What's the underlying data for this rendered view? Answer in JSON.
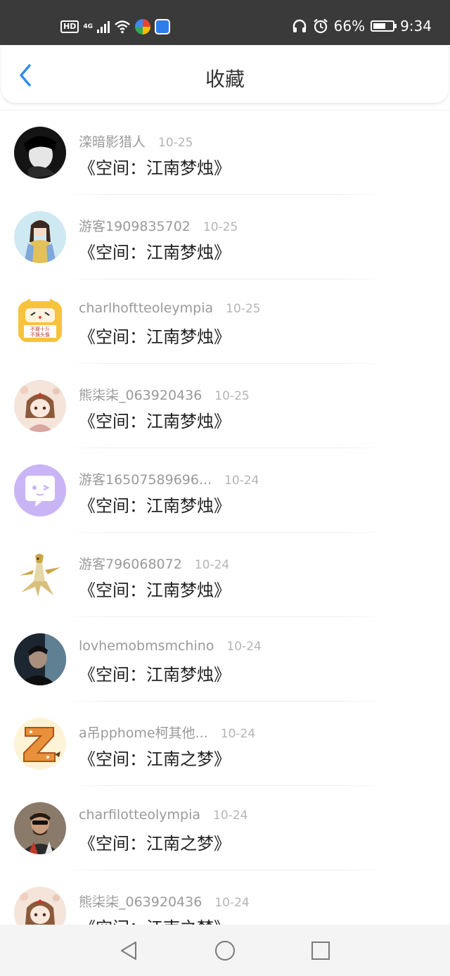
{
  "status_bar": {
    "hd": "HD",
    "network": "4G",
    "battery_percent": "66%",
    "time": "9:34",
    "battery_level": 0.66,
    "icons": [
      "hd-icon",
      "signal-icon",
      "wifi-icon",
      "app-notification-icon",
      "app-notification-icon",
      "headphones-icon",
      "alarm-icon",
      "battery-icon"
    ]
  },
  "header": {
    "title": "收藏",
    "back_icon": "chevron-left-icon",
    "accent_color": "#2d8cf0"
  },
  "items": [
    {
      "username": "滦暗影猎人",
      "date": "10-25",
      "work": "《空间：江南梦烛》"
    },
    {
      "username": "游客1909835702",
      "date": "10-25",
      "work": "《空间：江南梦烛》"
    },
    {
      "username": "charlhoftteoleympia",
      "date": "10-25",
      "work": "《空间：江南梦烛》"
    },
    {
      "username": "熊柒柒_063920436",
      "date": "10-25",
      "work": "《空间：江南梦烛》"
    },
    {
      "username": "游客16507589696...",
      "date": "10-24",
      "work": "《空间：江南梦烛》"
    },
    {
      "username": "游客796068072",
      "date": "10-24",
      "work": "《空间：江南梦烛》"
    },
    {
      "username": "lovhemobmsmchino",
      "date": "10-24",
      "work": "《空间：江南梦烛》"
    },
    {
      "username": "a吊pphome柯其他...",
      "date": "10-24",
      "work": "《空间：江南之梦》"
    },
    {
      "username": "charfilotteolympia",
      "date": "10-24",
      "work": "《空间：江南之梦》"
    },
    {
      "username": "熊柒柒_063920436",
      "date": "10-24",
      "work": "《空间：江南之梦》"
    }
  ],
  "nav_bar": {
    "back": "triangle-back-icon",
    "home": "circle-home-icon",
    "recents": "square-recents-icon"
  }
}
